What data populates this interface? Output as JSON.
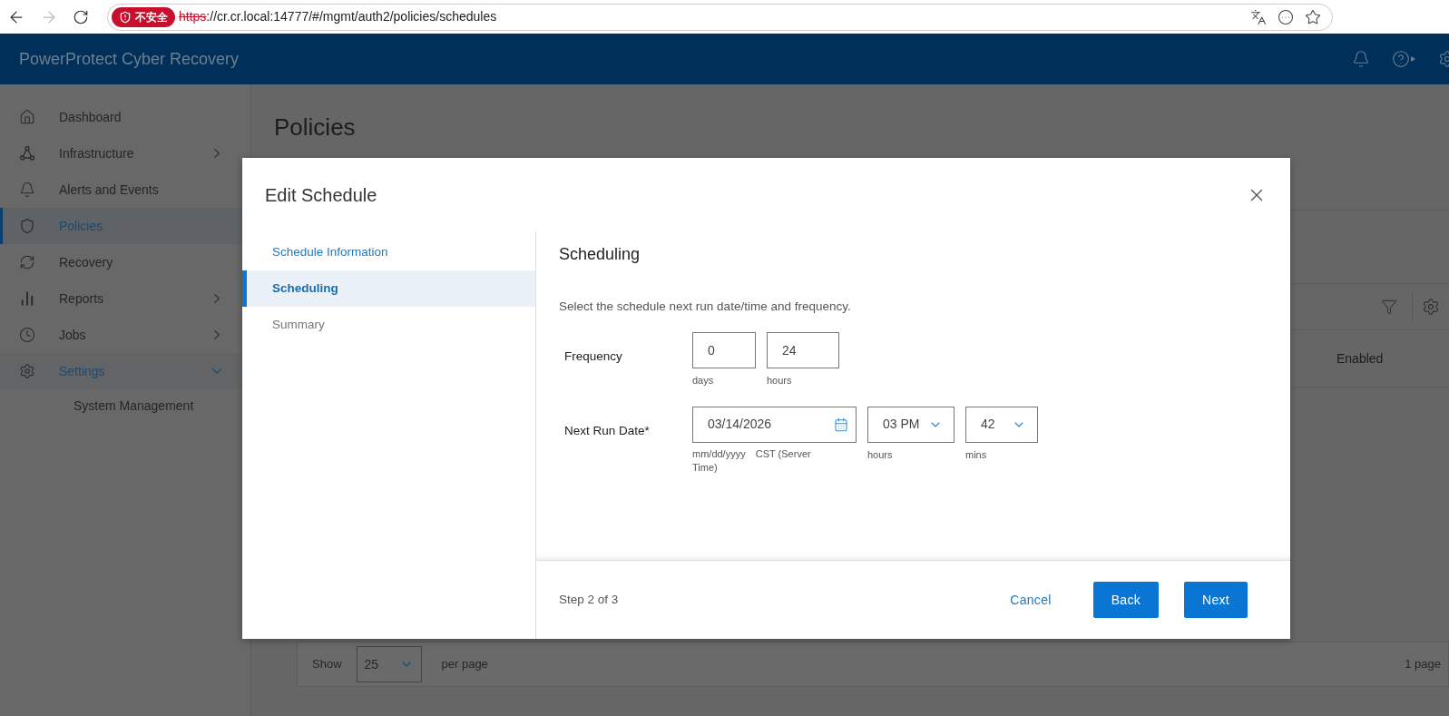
{
  "browser": {
    "insecure_label": "不安全",
    "url_scheme": "https",
    "url_rest": "://cr.cr.local:14777/#/mgmt/auth2/policies/schedules"
  },
  "app": {
    "title": "PowerProtect Cyber Recovery"
  },
  "sidebar": {
    "items": [
      {
        "label": "Dashboard",
        "kind": "leaf",
        "selected": false
      },
      {
        "label": "Infrastructure",
        "kind": "group",
        "expanded": false,
        "selected": false
      },
      {
        "label": "Alerts and Events",
        "kind": "leaf",
        "selected": false
      },
      {
        "label": "Policies",
        "kind": "leaf",
        "selected": true
      },
      {
        "label": "Recovery",
        "kind": "leaf",
        "selected": false
      },
      {
        "label": "Reports",
        "kind": "group",
        "expanded": false,
        "selected": false
      },
      {
        "label": "Jobs",
        "kind": "group",
        "expanded": false,
        "selected": false
      },
      {
        "label": "Settings",
        "kind": "group",
        "expanded": true,
        "selected": false,
        "children": [
          {
            "label": "System Management",
            "selected": false
          }
        ]
      }
    ]
  },
  "page": {
    "title": "Policies",
    "row_status": "Enabled",
    "pagination": {
      "show_label": "Show",
      "page_size": "25",
      "per_page": "per page",
      "pages": "1 page"
    }
  },
  "modal": {
    "title": "Edit Schedule",
    "steps": [
      {
        "label": "Schedule Information",
        "selected": false,
        "completed": true
      },
      {
        "label": "Scheduling",
        "selected": true,
        "completed": false
      },
      {
        "label": "Summary",
        "selected": false,
        "completed": false
      }
    ],
    "section_title": "Scheduling",
    "description": "Select the schedule next run date/time and frequency.",
    "frequency": {
      "label": "Frequency",
      "fields": [
        {
          "value": "0",
          "unit": "days"
        },
        {
          "value": "24",
          "unit": "hours"
        }
      ]
    },
    "next_run": {
      "label": "Next Run Date*",
      "date": {
        "value": "03/14/2026",
        "format": "mm/dd/yyyy",
        "timezone": "CST (Server Time)"
      },
      "hour": {
        "value": "03 PM",
        "unit": "hours"
      },
      "minute": {
        "value": "42",
        "unit": "mins"
      }
    },
    "footer": {
      "step_text": "Step 2 of 3",
      "buttons": [
        {
          "label": "Cancel",
          "kind": "link"
        },
        {
          "label": "Back",
          "kind": "primary"
        },
        {
          "label": "Next",
          "kind": "primary"
        }
      ]
    }
  }
}
